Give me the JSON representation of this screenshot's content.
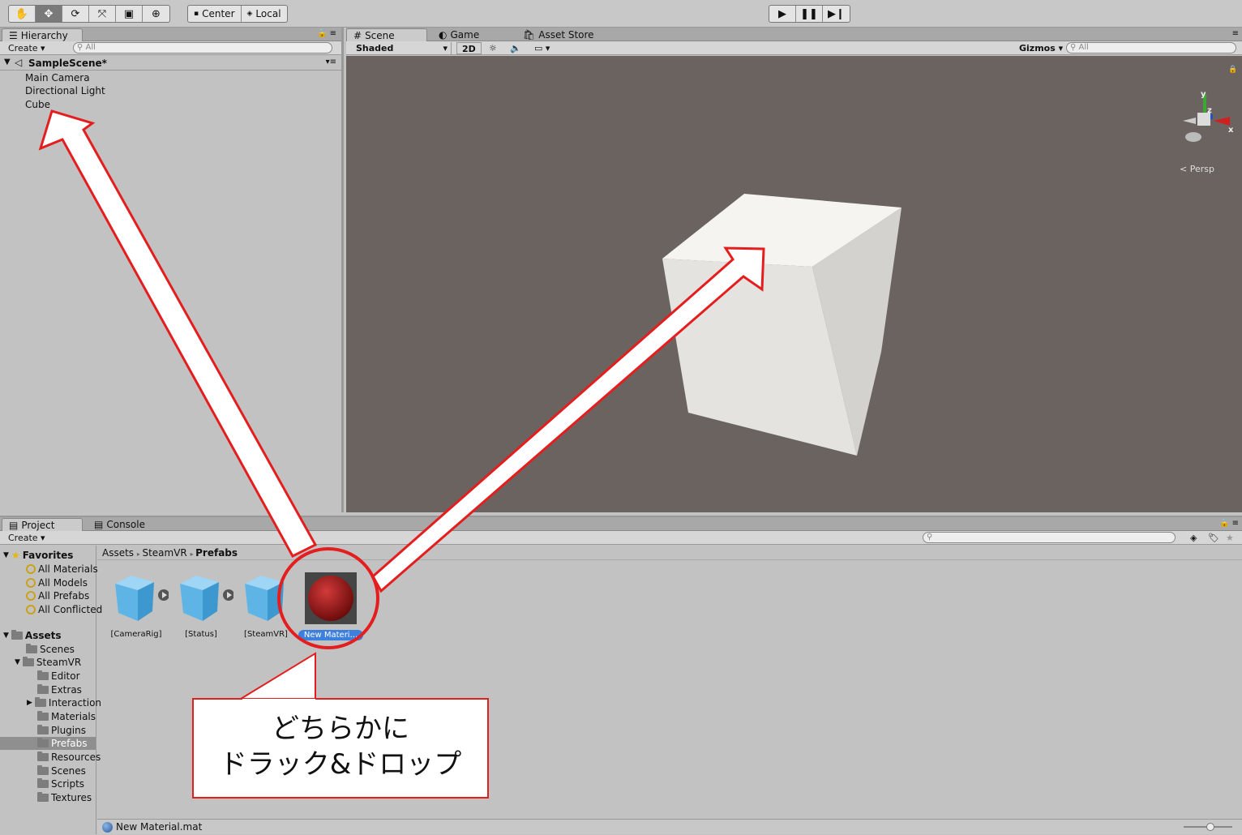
{
  "toolbar": {
    "tools": [
      "hand-icon",
      "move-icon",
      "rotate-icon",
      "scale-icon",
      "rect-icon",
      "transform-icon"
    ],
    "pivot_label": "Center",
    "space_label": "Local",
    "play": [
      "play-icon",
      "pause-icon",
      "step-icon"
    ]
  },
  "hierarchy": {
    "tab_label": "Hierarchy",
    "create_label": "Create",
    "search_placeholder": "All",
    "scene_name": "SampleScene*",
    "items": [
      "Main Camera",
      "Directional Light",
      "Cube"
    ]
  },
  "scene": {
    "tabs": [
      "Scene",
      "Game",
      "Asset Store"
    ],
    "shading_mode": "Shaded",
    "mode_2d": "2D",
    "gizmos_label": "Gizmos",
    "search_placeholder": "All",
    "projection_label": "Persp",
    "axis_x": "x",
    "axis_y": "y",
    "axis_z": "z"
  },
  "project": {
    "tabs": [
      "Project",
      "Console"
    ],
    "create_label": "Create",
    "favorites_label": "Favorites",
    "favorites": [
      "All Materials",
      "All Models",
      "All Prefabs",
      "All Conflicted"
    ],
    "assets_label": "Assets",
    "asset_folders": [
      "Scenes",
      "SteamVR"
    ],
    "steamvr_folders": [
      "Editor",
      "Extras",
      "Interaction",
      "Materials",
      "Plugins",
      "Prefabs",
      "Resources",
      "Scenes",
      "Scripts",
      "Textures"
    ],
    "breadcrumb": [
      "Assets",
      "SteamVR",
      "Prefabs"
    ],
    "assets": [
      "[CameraRig]",
      "[Status]",
      "[SteamVR]",
      "New Materi..."
    ],
    "status_file": "New Material.mat"
  },
  "callout": {
    "line1": "どちらかに",
    "line2": "ドラック&ドロップ"
  },
  "colors": {
    "annotation_red": "#e41e1e",
    "viewport_bg": "#6b6360",
    "selection_blue": "#3d7fdc"
  }
}
